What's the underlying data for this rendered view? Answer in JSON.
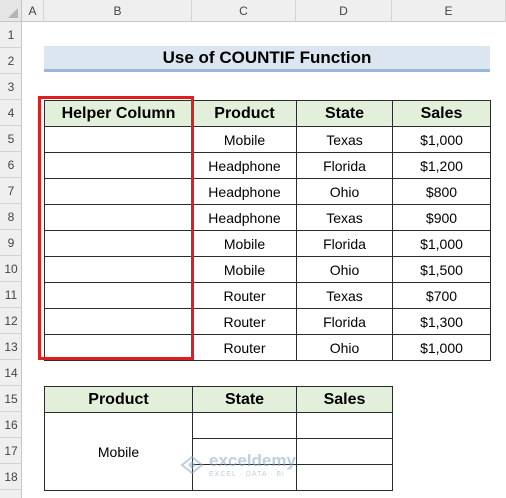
{
  "sheet": {
    "columns": [
      "A",
      "B",
      "C",
      "D",
      "E"
    ],
    "rows": [
      "1",
      "2",
      "3",
      "4",
      "5",
      "6",
      "7",
      "8",
      "9",
      "10",
      "11",
      "12",
      "13",
      "14",
      "15",
      "16",
      "17",
      "18"
    ]
  },
  "title": "Use of COUNTIF Function",
  "main_table": {
    "headers": [
      "Helper Column",
      "Product",
      "State",
      "Sales"
    ],
    "rows": [
      [
        "",
        "Mobile",
        "Texas",
        "$1,000"
      ],
      [
        "",
        "Headphone",
        "Florida",
        "$1,200"
      ],
      [
        "",
        "Headphone",
        "Ohio",
        "$800"
      ],
      [
        "",
        "Headphone",
        "Texas",
        "$900"
      ],
      [
        "",
        "Mobile",
        "Florida",
        "$1,000"
      ],
      [
        "",
        "Mobile",
        "Ohio",
        "$1,500"
      ],
      [
        "",
        "Router",
        "Texas",
        "$700"
      ],
      [
        "",
        "Router",
        "Florida",
        "$1,300"
      ],
      [
        "",
        "Router",
        "Ohio",
        "$1,000"
      ]
    ]
  },
  "lookup_table": {
    "headers": [
      "Product",
      "State",
      "Sales"
    ],
    "product_value": "Mobile"
  },
  "colors": {
    "header_fill": "#e2efda",
    "title_fill": "#dce6f1",
    "highlight_border": "#e01e1e"
  },
  "watermark": {
    "name": "exceldemy",
    "tagline": "EXCEL · DATA · BI"
  }
}
